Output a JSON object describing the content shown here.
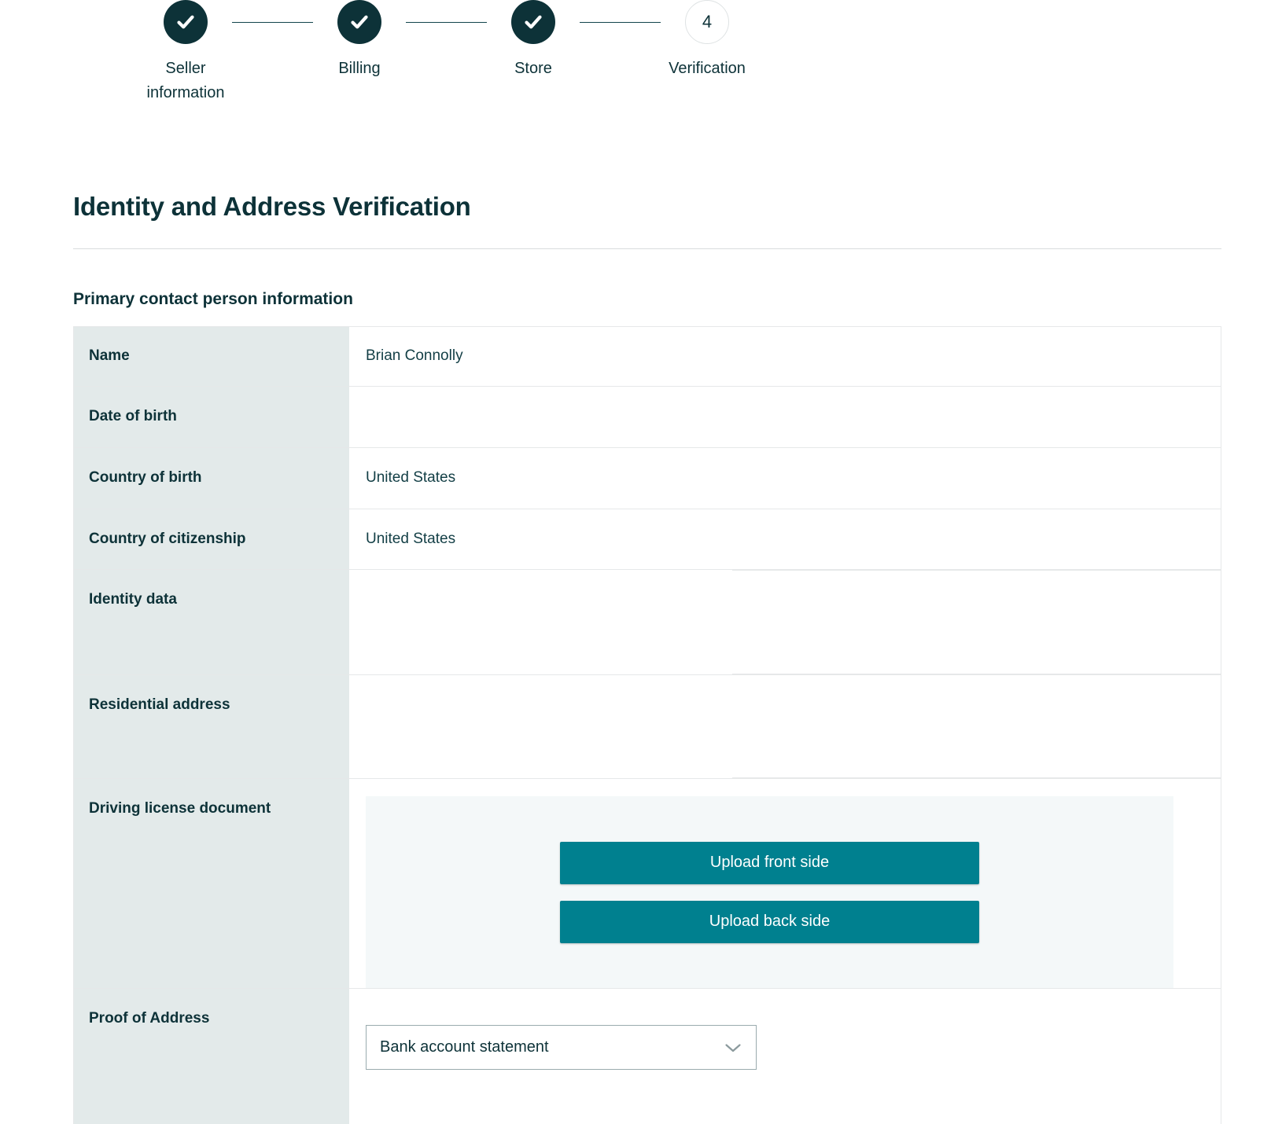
{
  "stepper": {
    "steps": [
      {
        "label": "Seller\ninformation",
        "state": "complete",
        "icon": "check-icon"
      },
      {
        "label": "Billing",
        "state": "complete",
        "icon": "check-icon"
      },
      {
        "label": "Store",
        "state": "complete",
        "icon": "check-icon"
      },
      {
        "label": "Verification",
        "state": "current",
        "number": "4"
      }
    ]
  },
  "page": {
    "title": "Identity and Address Verification",
    "section_title": "Primary contact person information"
  },
  "table": {
    "rows": [
      {
        "label": "Name",
        "value": "Brian Connolly"
      },
      {
        "label": "Date of birth",
        "value": ""
      },
      {
        "label": "Country of birth",
        "value": "United States"
      },
      {
        "label": "Country of citizenship",
        "value": "United States"
      },
      {
        "label": "Identity data",
        "value": ""
      },
      {
        "label": "Residential address",
        "value": ""
      },
      {
        "label": "Driving license document",
        "value": ""
      },
      {
        "label": "Proof of Address",
        "value": ""
      }
    ]
  },
  "license_upload": {
    "front_label": "Upload front side",
    "back_label": "Upload back side"
  },
  "proof_of_address": {
    "selected": "Bank account statement",
    "chevron_icon": "chevron-down-icon"
  },
  "colors": {
    "accent_teal": "#00808f",
    "ink": "#0d3238",
    "label_bg": "#e3eaea",
    "panel_bg": "#f4f8f9"
  }
}
